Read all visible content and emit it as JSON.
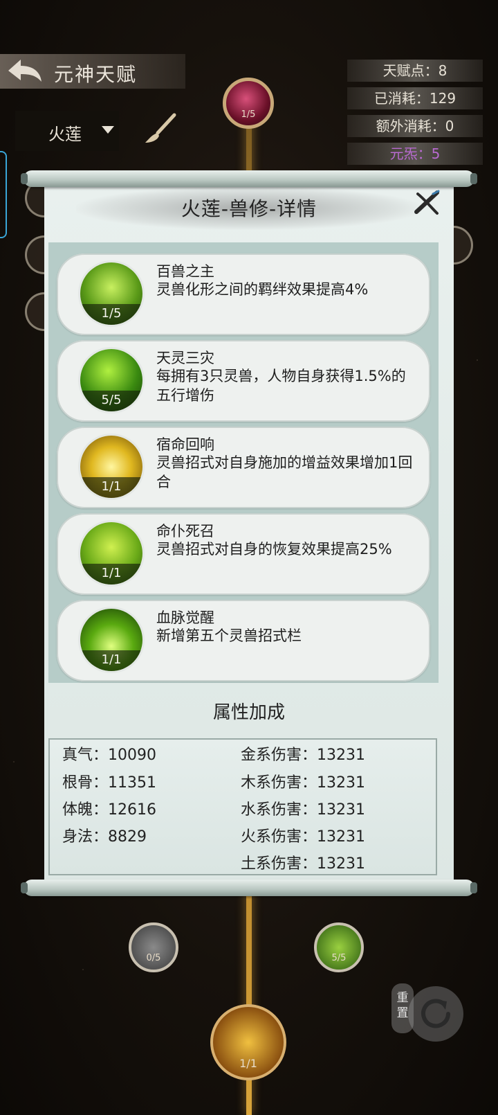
{
  "header": {
    "title": "元神天赋",
    "stats": [
      {
        "label": "天赋点：8"
      },
      {
        "label": "已消耗：129"
      },
      {
        "label": "额外消耗：0"
      },
      {
        "label": "元炁：5"
      }
    ],
    "selector_value": "火莲"
  },
  "tree": {
    "top_node_count": "1/5",
    "bottom_left_count": "0/5",
    "bottom_right_count": "5/5",
    "bottom_center_count": "1/1",
    "reset_label": "重置"
  },
  "panel": {
    "title": "火莲-兽修-详情",
    "talents": [
      {
        "name": "百兽之主",
        "desc": "灵兽化形之间的羁绊效果提高4%",
        "count": "1/5",
        "icon": "beast-lord-icon"
      },
      {
        "name": "天灵三灾",
        "desc": "每拥有3只灵兽，人物自身获得1.5%的五行增伤",
        "count": "5/5",
        "icon": "three-calamities-icon"
      },
      {
        "name": "宿命回响",
        "desc": "灵兽招式对自身施加的增益效果增加1回合",
        "count": "1/1",
        "icon": "fate-echo-icon"
      },
      {
        "name": "命仆死召",
        "desc": "灵兽招式对自身的恢复效果提高25%",
        "count": "1/1",
        "icon": "servant-summon-icon"
      },
      {
        "name": "血脉觉醒",
        "desc": "新增第五个灵兽招式栏",
        "count": "1/1",
        "icon": "bloodline-awaken-icon"
      }
    ],
    "attributes_title": "属性加成",
    "attributes_left": [
      "真气：10090",
      "根骨：11351",
      "体魄：12616",
      "身法：8829"
    ],
    "attributes_right": [
      "金系伤害：13231",
      "木系伤害：13231",
      "水系伤害：13231",
      "火系伤害：13231",
      "土系伤害：13231"
    ]
  },
  "colors": {
    "panel_bg": "#e9f0ee",
    "list_bg": "#b6ccc8",
    "accent_purple": "#b86ad0",
    "trunk_gold": "#d8a43a"
  }
}
